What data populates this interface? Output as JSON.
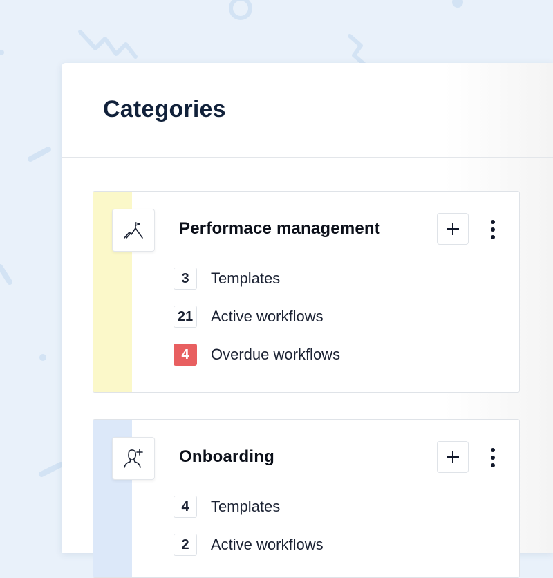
{
  "page": {
    "title": "Categories"
  },
  "colors": {
    "background": "#e9f1fa",
    "performance_stripe": "#fbf8c9",
    "onboarding_stripe": "#dce8f9",
    "overdue_badge": "#e85f60"
  },
  "categories": [
    {
      "name": "Performace management",
      "icon": "mountain-flag-icon",
      "stats": [
        {
          "count": "3",
          "label": "Templates"
        },
        {
          "count": "21",
          "label": "Active workflows"
        },
        {
          "count": "4",
          "label": "Overdue workflows",
          "status": "overdue"
        }
      ]
    },
    {
      "name": "Onboarding",
      "icon": "add-person-icon",
      "stats": [
        {
          "count": "4",
          "label": "Templates"
        },
        {
          "count": "2",
          "label": "Active workflows"
        }
      ]
    }
  ],
  "actions": {
    "add_icon": "plus-icon",
    "more_icon": "more-vertical-icon"
  }
}
